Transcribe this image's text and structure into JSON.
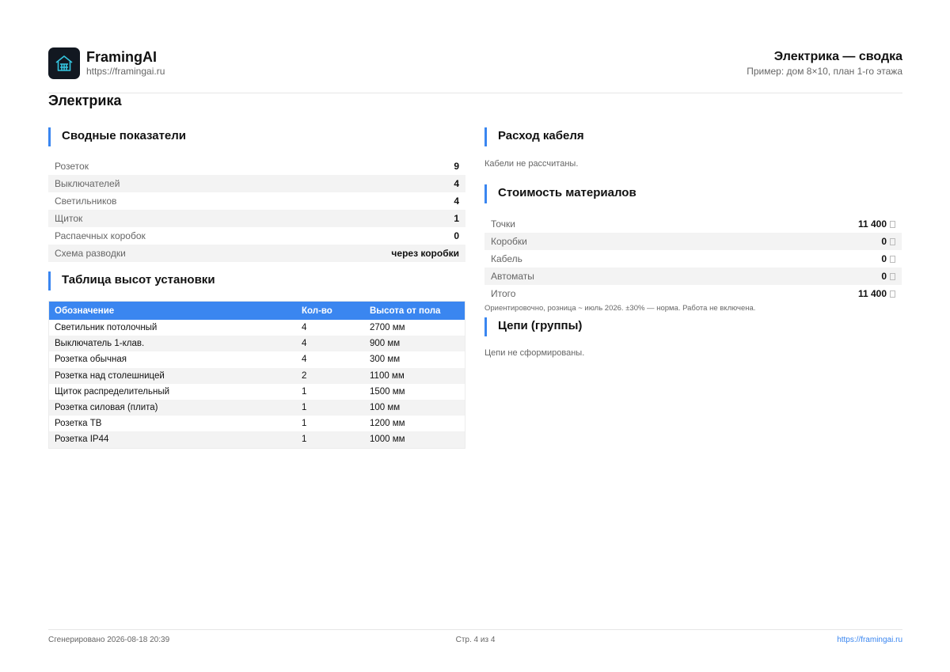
{
  "header": {
    "brand_name": "FramingAI",
    "brand_url": "https://framingai.ru",
    "doc_title": "Электрика — сводка",
    "doc_subtitle": "Пример: дом 8×10, план 1-го этажа"
  },
  "page_title": "Электрика",
  "summary": {
    "title": "Сводные показатели",
    "rows": [
      {
        "label": "Розеток",
        "value": "9"
      },
      {
        "label": "Выключателей",
        "value": "4"
      },
      {
        "label": "Светильников",
        "value": "4"
      },
      {
        "label": "Щиток",
        "value": "1"
      },
      {
        "label": "Распаечных коробок",
        "value": "0"
      },
      {
        "label": "Схема разводки",
        "value": "через коробки"
      }
    ]
  },
  "heights": {
    "title": "Таблица высот установки",
    "columns": [
      "Обозначение",
      "Кол-во",
      "Высота от пола"
    ],
    "rows": [
      [
        "Светильник потолочный",
        "4",
        "2700 мм"
      ],
      [
        "Выключатель 1-клав.",
        "4",
        "900 мм"
      ],
      [
        "Розетка обычная",
        "4",
        "300 мм"
      ],
      [
        "Розетка над столешницей",
        "2",
        "1100 мм"
      ],
      [
        "Щиток распределительный",
        "1",
        "1500 мм"
      ],
      [
        "Розетка силовая (плита)",
        "1",
        "100 мм"
      ],
      [
        "Розетка ТВ",
        "1",
        "1200 мм"
      ],
      [
        "Розетка IP44",
        "1",
        "1000 мм"
      ]
    ]
  },
  "cable": {
    "title": "Расход кабеля",
    "empty_text": "Кабели не рассчитаны."
  },
  "costs": {
    "title": "Стоимость материалов",
    "rows": [
      {
        "label": "Точки",
        "value": "11 400"
      },
      {
        "label": "Коробки",
        "value": "0"
      },
      {
        "label": "Кабель",
        "value": "0"
      },
      {
        "label": "Автоматы",
        "value": "0"
      },
      {
        "label": "Итого",
        "value": "11 400"
      }
    ],
    "note": "Ориентировочно, розница ~ июль 2026. ±30% — норма. Работа не включена."
  },
  "circuits": {
    "title": "Цепи (группы)",
    "empty_text": "Цепи не сформированы."
  },
  "footer": {
    "generated": "Сгенерировано 2026-08-18 20:39",
    "page": "Стр. 4 из 4",
    "url": "https://framingai.ru"
  },
  "colors": {
    "accent": "#3a86f0",
    "logo_bg": "#121821",
    "logo_icon": "#35c6e0"
  },
  "icons": {
    "logo": "house-frame-icon",
    "currency": "missing-glyph-box"
  }
}
